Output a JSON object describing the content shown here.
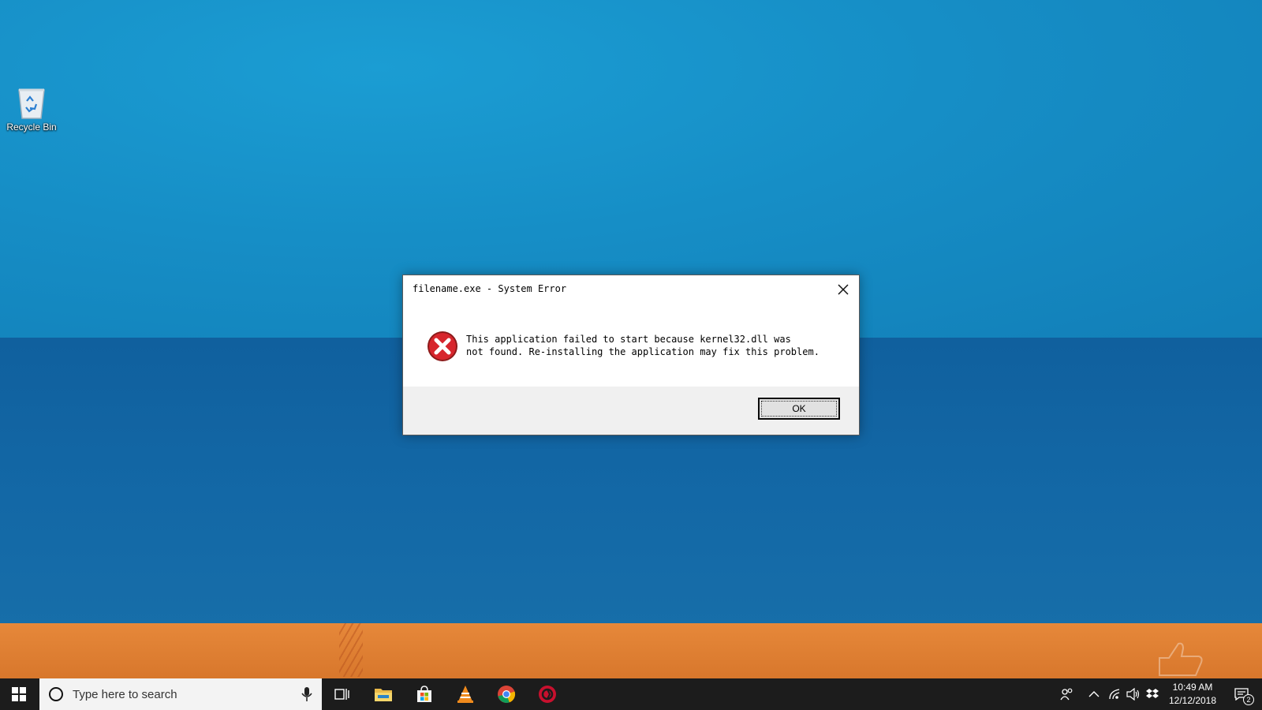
{
  "desktop": {
    "icons": [
      {
        "label": "Recycle Bin",
        "icon": "recycle-bin-icon"
      }
    ]
  },
  "dialog": {
    "title": "filename.exe - System Error",
    "message": "This application failed to start because kernel32.dll was\nnot found. Re-installing the application may fix this problem.",
    "ok_label": "OK",
    "icon": "error-icon"
  },
  "taskbar": {
    "search_placeholder": "Type here to search",
    "pinned": [
      "task-view-icon",
      "file-explorer-icon",
      "microsoft-store-icon",
      "vlc-icon",
      "chrome-icon",
      "app-icon"
    ],
    "clock": {
      "time": "10:49 AM",
      "date": "12/12/2018"
    },
    "notification_count": "2"
  },
  "colors": {
    "sky": "#168ec6",
    "sea": "#1368a6",
    "sand": "#e0802f",
    "taskbar": "#1c1c1c",
    "error_red": "#c8102e"
  }
}
